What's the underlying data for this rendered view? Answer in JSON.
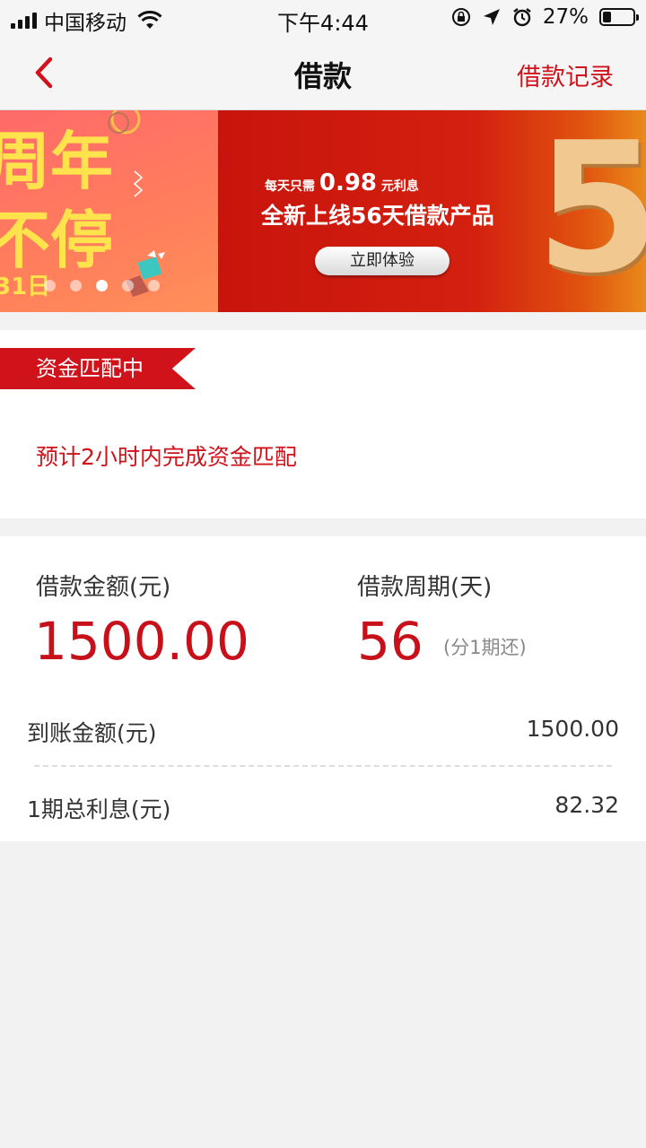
{
  "status_bar": {
    "carrier": "中国移动",
    "time": "下午4:44",
    "battery_percent": "27%",
    "battery_level": 0.27
  },
  "nav": {
    "title": "借款",
    "right_link": "借款记录"
  },
  "banner": {
    "prev_slide_line1": "周年",
    "prev_slide_line2": "不停",
    "prev_slide_date": "31日",
    "line1_prefix": "每天只需",
    "line1_number": "0.98",
    "line1_suffix": "元利息",
    "line2": "全新上线56天借款产品",
    "button_label": "立即体验",
    "big_digit": "5",
    "dot_count": 5,
    "active_dot_index": 2
  },
  "status_card": {
    "badge": "资金匹配中",
    "message": "预计2小时内完成资金匹配"
  },
  "loan": {
    "amount_label": "借款金额(元)",
    "amount_value": "1500.00",
    "period_label": "借款周期(天)",
    "period_value": "56",
    "period_note": "(分1期还)",
    "received_label": "到账金额(元)",
    "received_value": "1500.00",
    "interest_label": "1期总利息(元)",
    "interest_value": "82.32"
  },
  "colors": {
    "accent": "#d0121b",
    "page_bg": "#f2f2f2"
  }
}
